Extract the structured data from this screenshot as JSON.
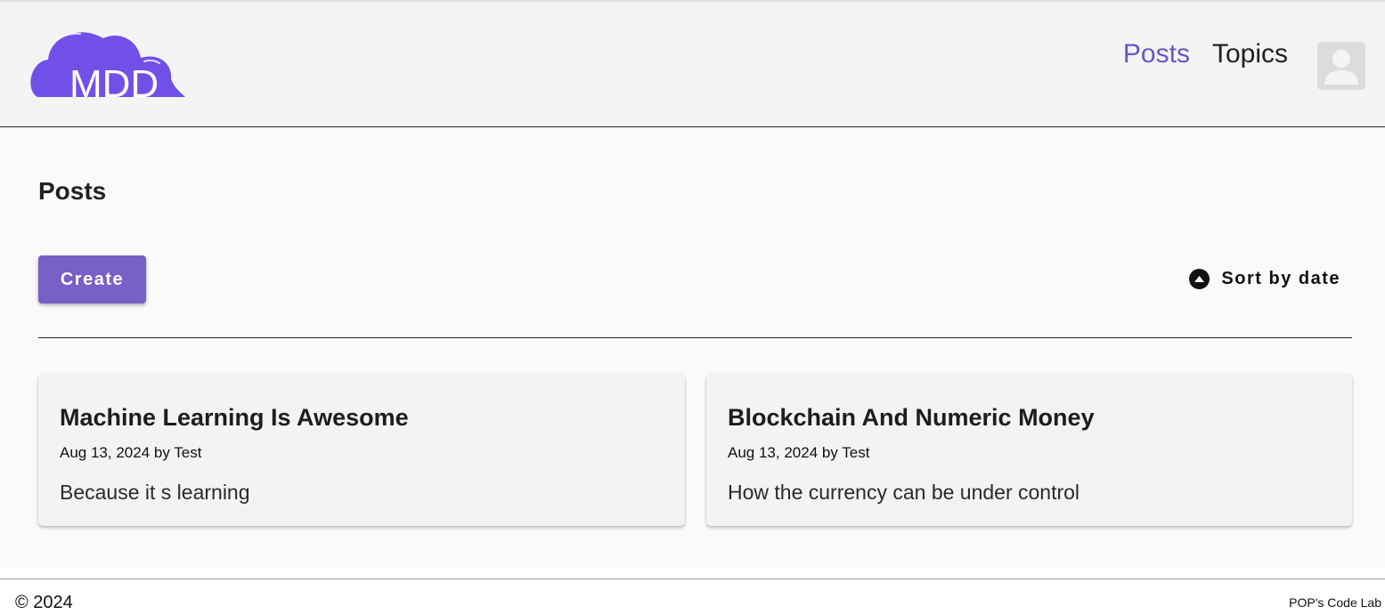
{
  "header": {
    "logo_text": "MDD",
    "nav": [
      {
        "label": "Posts",
        "active": true
      },
      {
        "label": "Topics",
        "active": false
      }
    ]
  },
  "main": {
    "title": "Posts",
    "create_label": "Create",
    "sort_label": "Sort by date",
    "posts": [
      {
        "title": "Machine Learning Is Awesome",
        "meta": "Aug 13, 2024 by Test",
        "body": "Because it s learning"
      },
      {
        "title": "Blockchain And Numeric Money",
        "meta": "Aug 13, 2024 by Test",
        "body": "How the currency can be under control"
      }
    ]
  },
  "footer": {
    "copyright": "© 2024",
    "brand": "POP's Code Lab"
  },
  "colors": {
    "accent": "#7760c6",
    "logo": "#7150e8",
    "nav_active": "#6a55c6"
  },
  "icons": [
    "cloud-logo",
    "user-avatar-icon",
    "arrow-up-circle-icon"
  ]
}
